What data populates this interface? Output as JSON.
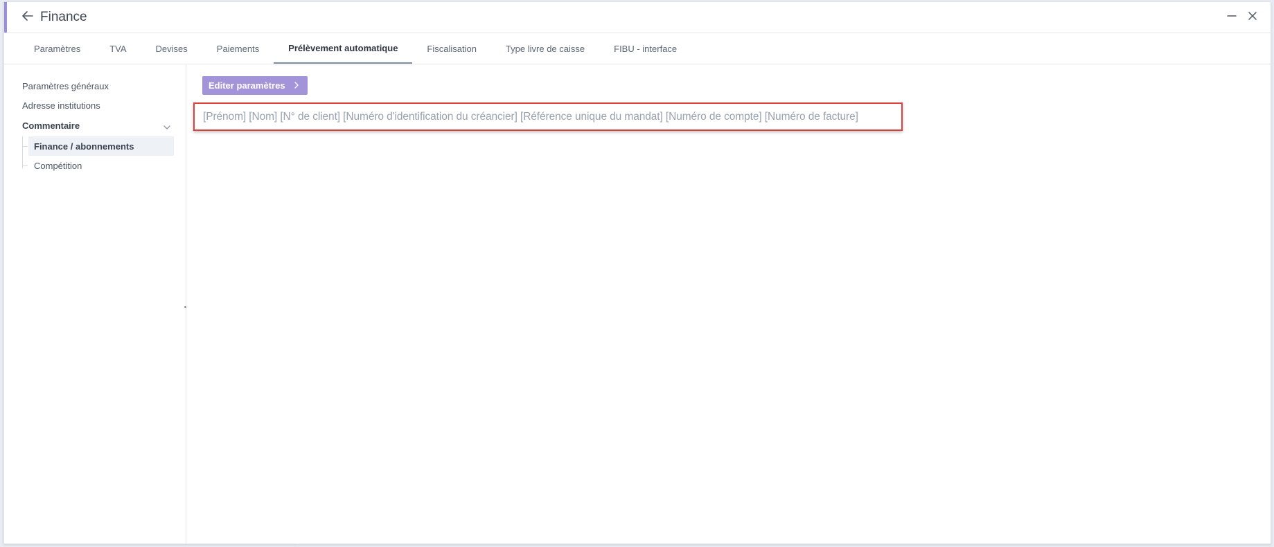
{
  "window": {
    "title": "Finance",
    "accent_color": "#9b8fd6",
    "icons": {
      "back": "arrow-left-icon",
      "minimize": "minimize-icon",
      "close": "close-icon"
    }
  },
  "tabs": [
    {
      "label": "Paramètres",
      "active": false
    },
    {
      "label": "TVA",
      "active": false
    },
    {
      "label": "Devises",
      "active": false
    },
    {
      "label": "Paiements",
      "active": false
    },
    {
      "label": "Prélèvement automatique",
      "active": true
    },
    {
      "label": "Fiscalisation",
      "active": false
    },
    {
      "label": "Type livre de caisse",
      "active": false
    },
    {
      "label": "FIBU - interface",
      "active": false
    }
  ],
  "sidebar": {
    "items": [
      {
        "label": "Paramètres généraux"
      },
      {
        "label": "Adresse institutions"
      },
      {
        "label": "Commentaire",
        "expanded": true
      }
    ],
    "subitems": [
      {
        "label": "Finance / abonnements",
        "active": true
      },
      {
        "label": "Compétition",
        "active": false
      }
    ]
  },
  "main": {
    "edit_button_label": "Editer paramètres",
    "edit_button_color": "#a394d9",
    "placeholders_text": "[Prénom] [Nom] [N° de client] [Numéro d'identification du créancier] [Référence unique du mandat] [Numéro de compte] [Numéro de facture]",
    "highlight_color": "#e0403c"
  }
}
